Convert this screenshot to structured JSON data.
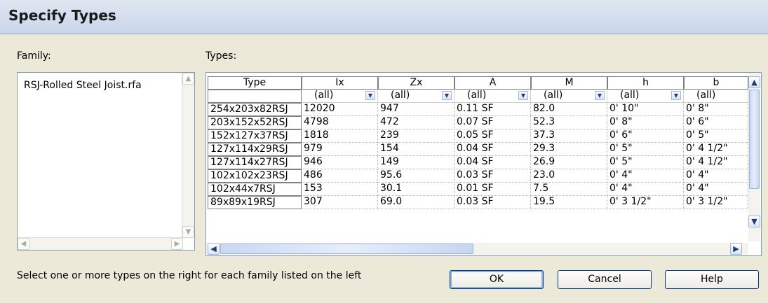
{
  "dialog": {
    "title": "Specify Types",
    "family_label": "Family:",
    "types_label": "Types:",
    "families": [
      "RSJ-Rolled Steel Joist.rfa"
    ],
    "instruction": "Select one or more types on the right for each family listed on the left",
    "buttons": {
      "ok": "OK",
      "cancel": "Cancel",
      "help": "Help"
    }
  },
  "grid": {
    "columns": [
      "Type",
      "Ix",
      "Zx",
      "A",
      "M",
      "h",
      "b"
    ],
    "filters": [
      "",
      "(all)",
      "(all)",
      "(all)",
      "(all)",
      "(all)",
      "(all)"
    ],
    "rows": [
      [
        "254x203x82RSJ",
        "12020",
        "947",
        "0.11 SF",
        "82.0",
        "0'  10\"",
        "0'  8\""
      ],
      [
        "203x152x52RSJ",
        "4798",
        "472",
        "0.07 SF",
        "52.3",
        "0'  8\"",
        "0'  6\""
      ],
      [
        "152x127x37RSJ",
        "1818",
        "239",
        "0.05 SF",
        "37.3",
        "0'  6\"",
        "0'  5\""
      ],
      [
        "127x114x29RSJ",
        "979",
        "154",
        "0.04 SF",
        "29.3",
        "0'  5\"",
        "0'  4 1/2\""
      ],
      [
        "127x114x27RSJ",
        "946",
        "149",
        "0.04 SF",
        "26.9",
        "0'  5\"",
        "0'  4 1/2\""
      ],
      [
        "102x102x23RSJ",
        "486",
        "95.6",
        "0.03 SF",
        "23.0",
        "0'  4\"",
        "0'  4\""
      ],
      [
        "102x44x7RSJ",
        "153",
        "30.1",
        "0.01 SF",
        "7.5",
        "0'  4\"",
        "0'  4\""
      ],
      [
        "89x89x19RSJ",
        "307",
        "69.0",
        "0.03 SF",
        "19.5",
        "0'  3 1/2\"",
        "0'  3 1/2\""
      ]
    ]
  },
  "icons": {
    "up": "▲",
    "down": "▼",
    "left": "◀",
    "right": "▶",
    "dropdown": "▼",
    "grip": "|||"
  }
}
